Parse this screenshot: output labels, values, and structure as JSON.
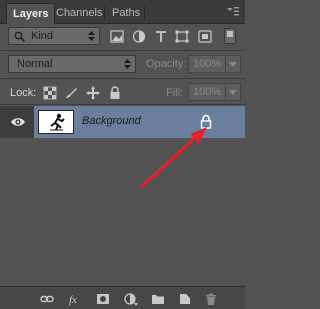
{
  "tabs": [
    {
      "label": "Layers"
    },
    {
      "label": "Channels"
    },
    {
      "label": "Paths"
    }
  ],
  "filter": {
    "kind_label": "Kind",
    "icons": [
      "pixel-filter-icon",
      "adjustment-filter-icon",
      "type-filter-icon",
      "shape-filter-icon",
      "smart-object-filter-icon"
    ]
  },
  "blend": {
    "mode": "Normal",
    "opacity_label": "Opacity:",
    "opacity_value": "100%"
  },
  "lock": {
    "label": "Lock:",
    "fill_label": "Fill:",
    "fill_value": "100%"
  },
  "layers": [
    {
      "name": "Background",
      "visible": true,
      "locked": true,
      "selected": true
    }
  ],
  "colors": {
    "panel": "#535353",
    "selection": "#6b7f9d",
    "annotation_arrow": "#e8202a"
  },
  "footer_icons": [
    "link-layers-icon",
    "fx-icon",
    "add-mask-icon",
    "adjustment-layer-icon",
    "new-group-icon",
    "new-layer-icon",
    "trash-icon"
  ]
}
